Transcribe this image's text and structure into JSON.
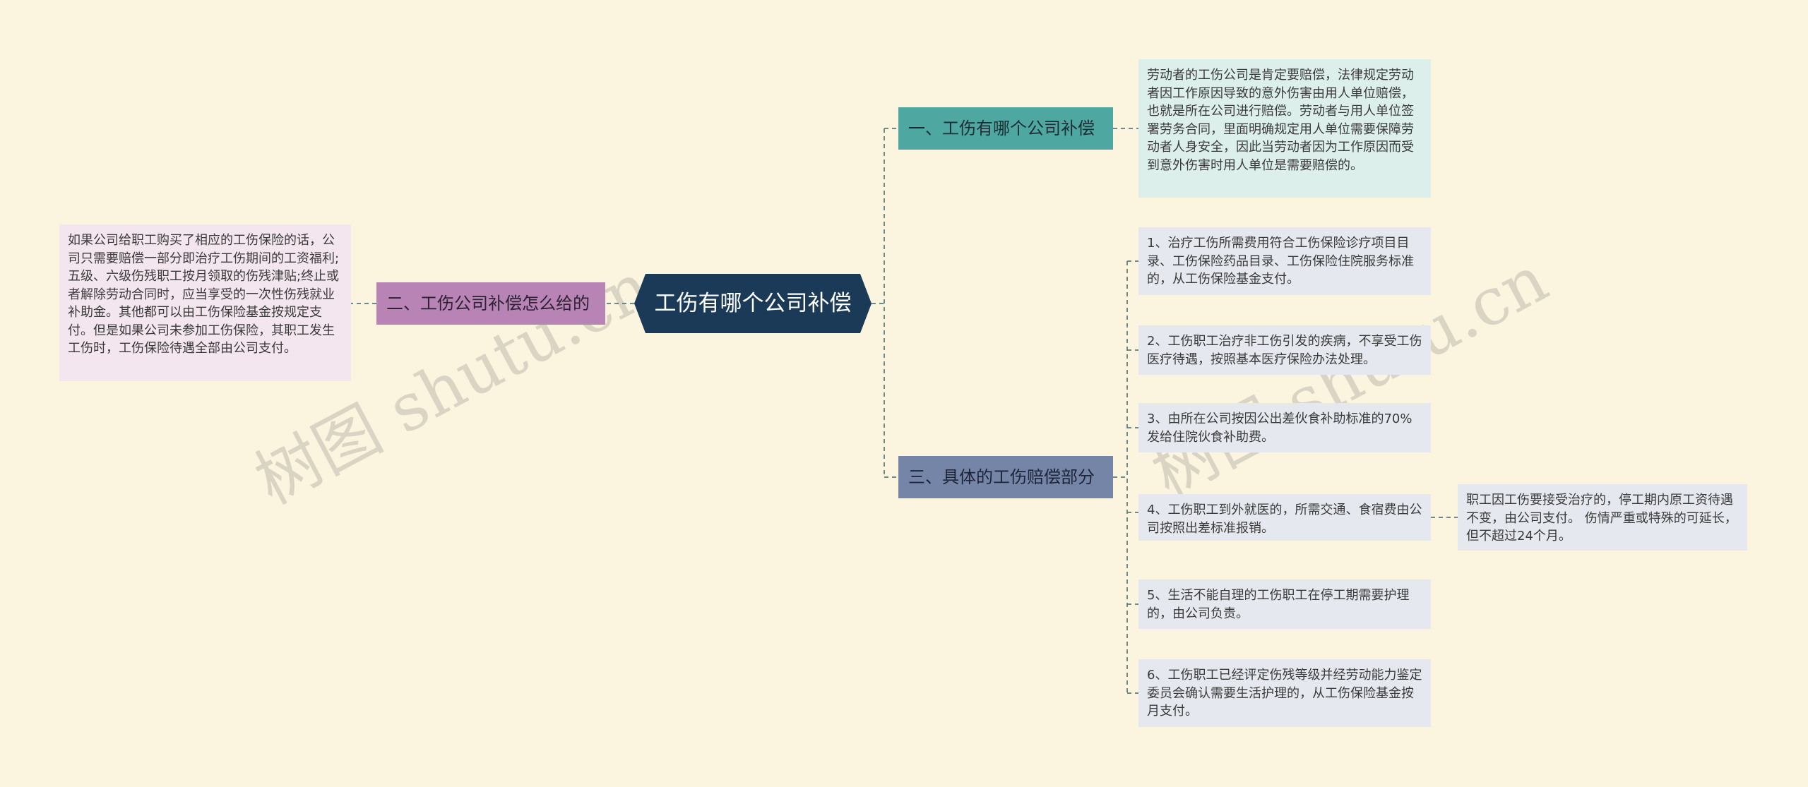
{
  "root": {
    "label": "工伤有哪个公司补偿"
  },
  "branches": [
    {
      "label": "一、工伤有哪个公司补偿",
      "leaves": [
        "劳动者的工伤公司是肯定要赔偿，法律规定劳动者因工作原因导致的意外伤害由用人单位赔偿，也就是所在公司进行赔偿。劳动者与用人单位签署劳务合同，里面明确规定用人单位需要保障劳动者人身安全，因此当劳动者因为工作原因而受到意外伤害时用人单位是需要赔偿的。"
      ]
    },
    {
      "label": "二、工伤公司补偿怎么给的",
      "leaves": [
        "如果公司给职工购买了相应的工伤保险的话，公司只需要赔偿一部分即治疗工伤期间的工资福利;五级、六级伤残职工按月领取的伤残津贴;终止或者解除劳动合同时，应当享受的一次性伤残就业补助金。其他都可以由工伤保险基金按规定支付。但是如果公司未参加工伤保险，其职工发生工伤时，工伤保险待遇全部由公司支付。"
      ]
    },
    {
      "label": "三、具体的工伤赔偿部分",
      "leaves": [
        "1、治疗工伤所需费用符合工伤保险诊疗项目目录、工伤保险药品目录、工伤保险住院服务标准的，从工伤保险基金支付。",
        "2、工伤职工治疗非工伤引发的疾病，不享受工伤医疗待遇，按照基本医疗保险办法处理。",
        "3、由所在公司按因公出差伙食补助标准的70%发给住院伙食补助费。",
        "4、工伤职工到外就医的，所需交通、食宿费由公司按照出差标准报销。",
        "5、生活不能自理的工伤职工在停工期需要护理的，由公司负责。",
        "6、工伤职工已经评定伤残等级并经劳动能力鉴定委员会确认需要生活护理的，从工伤保险基金按月支付。"
      ],
      "sub_leaf": "职工因工伤要接受治疗的，停工期内原工资待遇不变，由公司支付。 伤情严重或特殊的可延长，但不超过24个月。"
    }
  ],
  "watermarks": [
    "树图 shutu.cn",
    "树图 shutu.cn"
  ],
  "colors": {
    "background": "#fbf5df",
    "root": "#1a3a57",
    "branch_1": "#4ea7a1",
    "branch_2": "#b784b5",
    "branch_3": "#7585a8",
    "connector": "#6f8a86"
  }
}
